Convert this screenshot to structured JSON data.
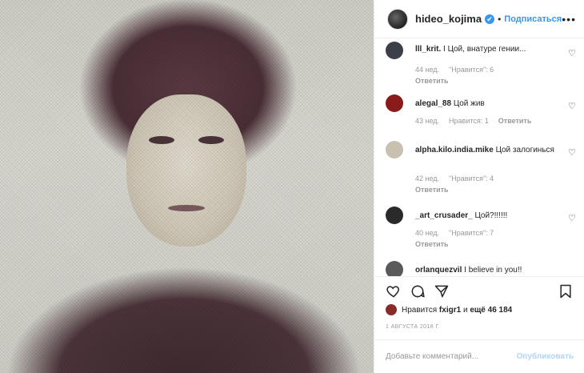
{
  "post": {
    "username": "hideo_kojima",
    "verified_mark": "✔",
    "dot": "•",
    "follow_label": "Подписаться",
    "more_icon": "•••"
  },
  "comments": [
    {
      "user": "lll_krit.",
      "text": "I Цой, внатуре гении...",
      "age": "44 нед.",
      "likes": "\"Нравится\": 6",
      "reply": "Ответить",
      "avatar_color": "#3b3f4a"
    },
    {
      "user": "alegal_88",
      "text": "Цой жив",
      "age": "43 нед.",
      "likes": "Нравится: 1",
      "reply": "Ответить",
      "avatar_color": "#8a1b1b"
    },
    {
      "user": "alpha.kilo.india.mike",
      "text": "Цой залогинься",
      "age": "42 нед.",
      "likes": "\"Нравится\": 4",
      "reply": "Ответить",
      "avatar_color": "#c9c0b1"
    },
    {
      "user": "_art_crusader_",
      "text": "Цой?!!!!!!",
      "age": "40 нед.",
      "likes": "\"Нравится\": 7",
      "reply": "Ответить",
      "avatar_color": "#2a2a2a"
    },
    {
      "user": "orlanquezvil",
      "text": "I believe in you!!",
      "avatar_color": "#5a5a5a"
    }
  ],
  "likes": {
    "prefix": "Нравится",
    "user": "fxigr1",
    "middle": "и",
    "rest": "ещё 46 184"
  },
  "date": "1 АВГУСТА 2018 Г.",
  "add_comment": {
    "placeholder": "Добавьте комментарий...",
    "post_label": "Опубликовать"
  },
  "colors": {
    "accent": "#3897f0",
    "post_disabled": "#b3d4f5"
  }
}
